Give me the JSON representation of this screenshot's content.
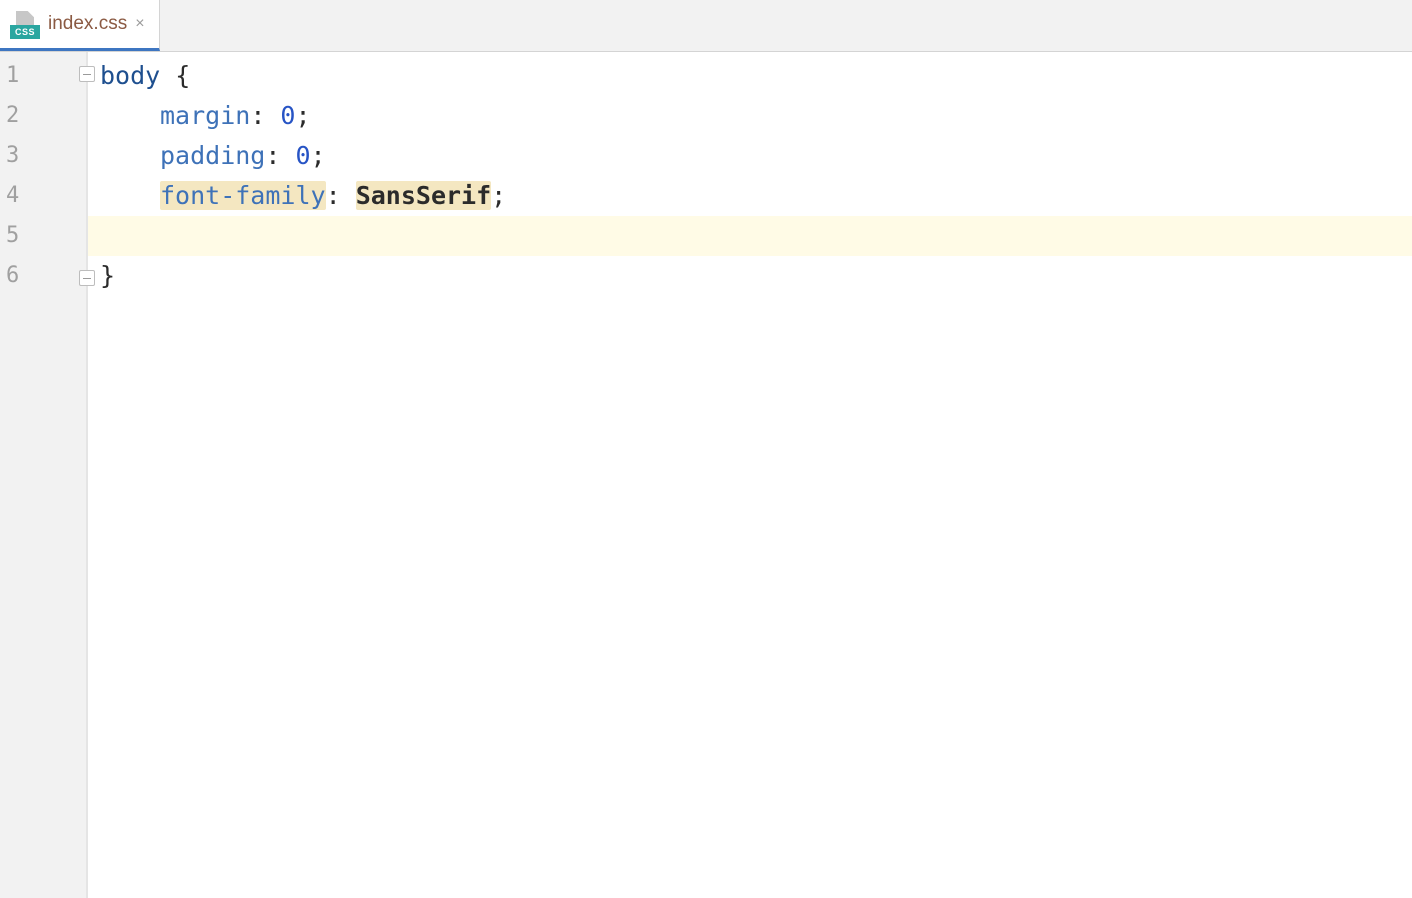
{
  "tab": {
    "filename": "index.css",
    "filetype_badge": "CSS"
  },
  "editor": {
    "line_numbers": [
      "1",
      "2",
      "3",
      "4",
      "5",
      "6"
    ],
    "current_line_index": 4,
    "code": {
      "l1": {
        "selector": "body",
        "brace_open": " {"
      },
      "l2": {
        "prop": "margin",
        "colon": ": ",
        "value": "0",
        "semi": ";"
      },
      "l3": {
        "prop": "padding",
        "colon": ": ",
        "value": "0",
        "semi": ";"
      },
      "l4": {
        "prop": "font-family",
        "colon": ": ",
        "value": "SansSerif",
        "semi": ";"
      },
      "l6": {
        "brace_close": "}"
      }
    }
  }
}
